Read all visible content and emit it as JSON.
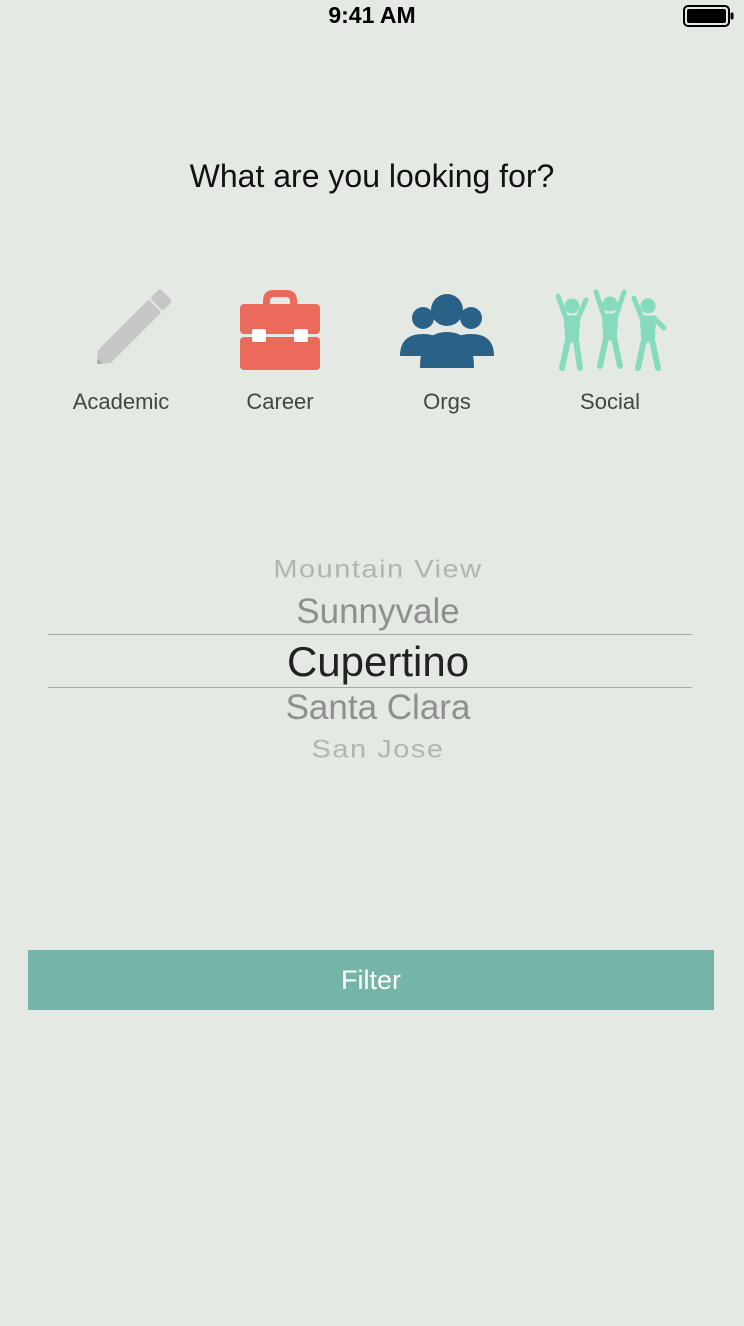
{
  "status_bar": {
    "time": "9:41 AM",
    "battery_icon": "battery-full-icon"
  },
  "question": "What are you looking for?",
  "categories": [
    {
      "label": "Academic",
      "icon": "pencil-icon",
      "color": "#c4c4c4"
    },
    {
      "label": "Career",
      "icon": "briefcase-icon",
      "color": "#ec6a5c"
    },
    {
      "label": "Orgs",
      "icon": "group-icon",
      "color": "#2a6186"
    },
    {
      "label": "Social",
      "icon": "people-celebrating-icon",
      "color": "#86dbbd"
    }
  ],
  "location_picker": {
    "options": [
      "Mountain View",
      "Sunnyvale",
      "Cupertino",
      "Santa Clara",
      "San Jose"
    ],
    "selected": "Cupertino"
  },
  "filter_button": {
    "label": "Filter",
    "color": "#75b4a8"
  },
  "colors": {
    "background": "#e5e9e4"
  }
}
